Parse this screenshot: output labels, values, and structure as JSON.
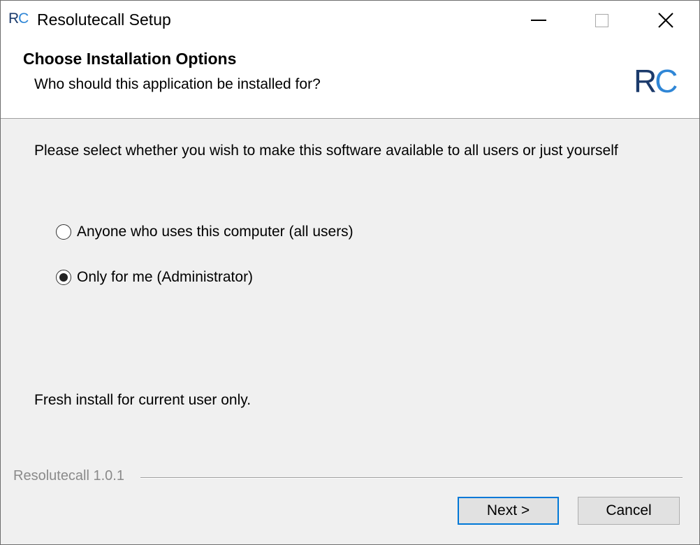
{
  "window": {
    "title": "Resolutecall Setup",
    "icon_text_r": "R",
    "icon_text_c": "C"
  },
  "header": {
    "title": "Choose Installation Options",
    "subtitle": "Who should this application be installed for?",
    "logo_r": "R",
    "logo_c": "C"
  },
  "main": {
    "prompt": "Please select whether you wish to make this software available to all users or just yourself",
    "options": [
      {
        "label": "Anyone who uses this computer (all users)",
        "selected": false
      },
      {
        "label": "Only for me (Administrator)",
        "selected": true
      }
    ],
    "status": "Fresh install for current user only."
  },
  "footer": {
    "brand": "Resolutecall 1.0.1",
    "next_label": "Next >",
    "cancel_label": "Cancel"
  },
  "colors": {
    "logo_dark": "#1b3a6b",
    "logo_light": "#2f86d6",
    "focus_border": "#0078d7"
  }
}
